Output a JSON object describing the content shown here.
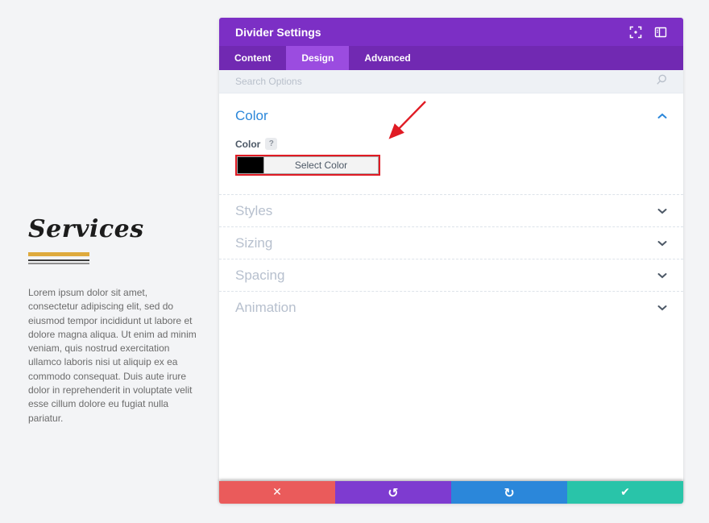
{
  "page": {
    "heading": "Services",
    "body_text": "Lorem ipsum dolor sit amet, consectetur adipiscing elit, sed do eiusmod tempor incididunt ut labore et dolore magna aliqua. Ut enim ad minim veniam, quis nostrud exercitation ullamco laboris nisi ut aliquip ex ea commodo consequat. Duis aute irure dolor in reprehenderit in voluptate velit esse cillum dolore eu fugiat nulla pariatur."
  },
  "modal": {
    "title": "Divider Settings",
    "tabs": [
      {
        "label": "Content",
        "active": false
      },
      {
        "label": "Design",
        "active": true
      },
      {
        "label": "Advanced",
        "active": false
      }
    ],
    "search": {
      "placeholder": "Search Options"
    },
    "color_section": {
      "title": "Color",
      "expanded": true,
      "field_label": "Color",
      "help_label": "?",
      "swatch_color": "#000000",
      "button_label": "Select Color"
    },
    "sections": [
      {
        "title": "Styles"
      },
      {
        "title": "Sizing"
      },
      {
        "title": "Spacing"
      },
      {
        "title": "Animation"
      }
    ],
    "actions": [
      {
        "name": "discard",
        "glyph": "✕"
      },
      {
        "name": "undo",
        "glyph": "↺"
      },
      {
        "name": "redo",
        "glyph": "↻"
      },
      {
        "name": "save",
        "glyph": "✔"
      }
    ]
  },
  "colors": {
    "page-bg": "#f3f4f6",
    "purple": "#7c2fc5",
    "tabbar": "#7129b2",
    "purple-light": "#9b4ce0",
    "blue": "#2b87da",
    "red": "#ea5b5b",
    "undo-purple": "#7e3bd0",
    "green": "#29c4a9",
    "annotation-red": "#e01b24",
    "gold": "#dfaa3d",
    "swatch-black": "#000000",
    "title-gray": "#b7c0ce",
    "search-bg": "#eef1f5"
  }
}
